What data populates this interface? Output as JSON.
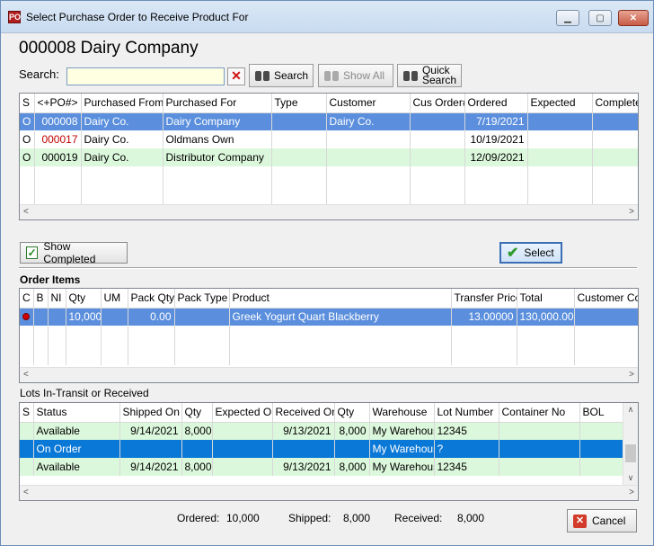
{
  "window": {
    "title": "Select Purchase Order to Receive Product For",
    "icon_label": "PO",
    "minimize": "▁",
    "maximize": "▢",
    "close": "✕"
  },
  "heading": "000008 Dairy Company",
  "search": {
    "label": "Search:",
    "value": "",
    "clear": "✕",
    "search_button": "Search",
    "show_all_button": "Show All",
    "quick_search_line1": "Quick",
    "quick_search_line2": "Search"
  },
  "po_grid": {
    "columns": [
      "S",
      "<+PO#>",
      "Purchased From",
      "Purchased For",
      "Type",
      "Customer",
      "Cus Order#",
      "Ordered",
      "Expected",
      "Complete"
    ],
    "rows": [
      {
        "s": "O",
        "po": "000008",
        "from": "Dairy Co.",
        "for": "Dairy Company",
        "type": "",
        "customer": "Dairy Co.",
        "cus_order": "",
        "ordered": "7/19/2021",
        "expected": "",
        "complete": ""
      },
      {
        "s": "O",
        "po": "000017",
        "from": "Dairy Co.",
        "for": "Oldmans Own",
        "type": "",
        "customer": "",
        "cus_order": "",
        "ordered": "10/19/2021",
        "expected": "",
        "complete": ""
      },
      {
        "s": "O",
        "po": "000019",
        "from": "Dairy Co.",
        "for": "Distributor Company",
        "type": "",
        "customer": "",
        "cus_order": "",
        "ordered": "12/09/2021",
        "expected": "",
        "complete": ""
      }
    ]
  },
  "show_completed_button": "Show Completed",
  "select_button": "Select",
  "order_items": {
    "title": "Order Items",
    "columns": [
      "C",
      "B",
      "NI",
      "Qty",
      "UM",
      "Pack Qty",
      "Pack Type",
      "Product",
      "Transfer Price",
      "Total",
      "Customer Code"
    ],
    "rows": [
      {
        "c": "",
        "b": "",
        "ni": "",
        "qty": "10,000",
        "um": "",
        "pack_qty": "0.00",
        "pack_type": "",
        "product": "Greek Yogurt Quart Blackberry",
        "transfer_price": "13.00000",
        "total": "130,000.00",
        "customer_code": ""
      }
    ]
  },
  "lots": {
    "title": "Lots In-Transit or Received",
    "columns": [
      "S",
      "Status",
      "Shipped On",
      "Qty",
      "Expected On",
      "Received On",
      "Qty",
      "Warehouse",
      "Lot Number",
      "Container No",
      "BOL"
    ],
    "rows": [
      {
        "s": "",
        "status": "Available",
        "shipped_on": "9/14/2021",
        "qty": "8,000",
        "expected_on": "",
        "received_on": "9/13/2021",
        "qty2": "8,000",
        "warehouse": "My Warehouse",
        "lot": "12345",
        "container": "",
        "bol": ""
      },
      {
        "s": "",
        "status": "On Order",
        "shipped_on": "",
        "qty": "",
        "expected_on": "",
        "received_on": "",
        "qty2": "",
        "warehouse": "My Warehouse",
        "lot": "?",
        "container": "",
        "bol": ""
      },
      {
        "s": "",
        "status": "Available",
        "shipped_on": "9/14/2021",
        "qty": "8,000",
        "expected_on": "",
        "received_on": "9/13/2021",
        "qty2": "8,000",
        "warehouse": "My Warehouse",
        "lot": "12345",
        "container": "",
        "bol": ""
      }
    ]
  },
  "totals": {
    "ordered_label": "Ordered:",
    "ordered_value": "10,000",
    "shipped_label": "Shipped:",
    "shipped_value": "8,000",
    "received_label": "Received:",
    "received_value": "8,000"
  },
  "cancel_button": "Cancel",
  "scroll": {
    "left": "<",
    "right": ">",
    "up": "∧",
    "down": "∨"
  },
  "colors": {
    "selected_row": "#5b8fdd",
    "available_row": "#dcf8dc",
    "po_red": "#c00000"
  }
}
